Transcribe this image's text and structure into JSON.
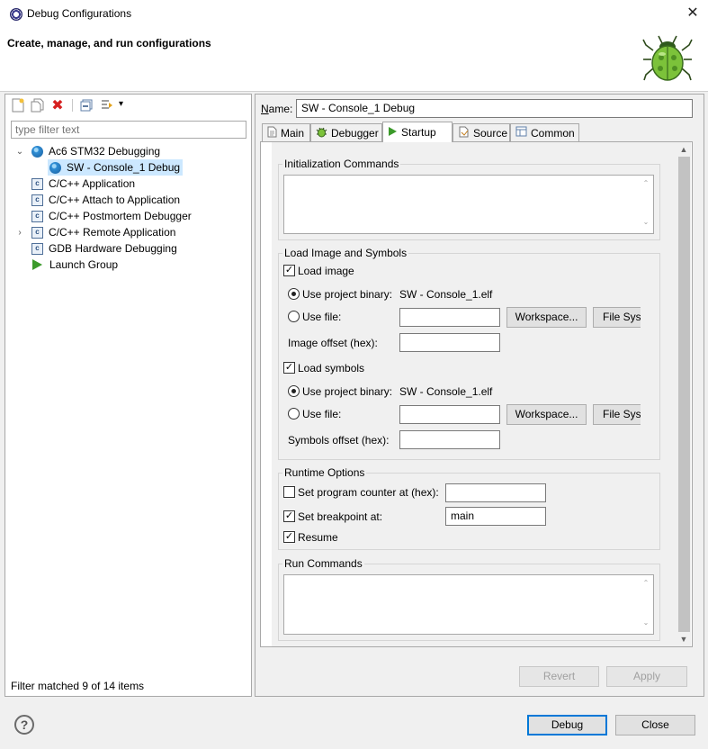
{
  "window": {
    "title": "Debug Configurations",
    "close_glyph": "✕",
    "banner_text": "Create, manage, and run configurations"
  },
  "left": {
    "filter_placeholder": "type filter text",
    "tree": [
      {
        "label": "Ac6 STM32 Debugging",
        "icon": "globe-icon",
        "expanded": true
      },
      {
        "label": "SW - Console_1 Debug",
        "icon": "globe-icon",
        "selected": true
      },
      {
        "label": "C/C++ Application",
        "icon": "c-icon"
      },
      {
        "label": "C/C++ Attach to Application",
        "icon": "c-icon"
      },
      {
        "label": "C/C++ Postmortem Debugger",
        "icon": "c-icon"
      },
      {
        "label": "C/C++ Remote Application",
        "icon": "c-icon",
        "collapsed": true
      },
      {
        "label": "GDB Hardware Debugging",
        "icon": "c-icon"
      },
      {
        "label": "Launch Group",
        "icon": "launch-icon"
      }
    ],
    "status": "Filter matched 9 of 14 items"
  },
  "right": {
    "name_label": "Name:",
    "name_value": "SW - Console_1 Debug",
    "tabs": [
      {
        "label": "Main",
        "icon": "main-icon"
      },
      {
        "label": "Debugger",
        "icon": "bug-small-icon"
      },
      {
        "label": "Startup",
        "icon": "run-icon",
        "active": true
      },
      {
        "label": "Source",
        "icon": "source-icon"
      },
      {
        "label": "Common",
        "icon": "common-icon"
      }
    ],
    "init": {
      "title": "Initialization Commands"
    },
    "load": {
      "title": "Load Image and Symbols",
      "load_image": "Load image",
      "load_image_checked": true,
      "use_project_binary": "Use project binary:",
      "image_binary": "SW - Console_1.elf",
      "use_file": "Use file:",
      "workspace": "Workspace...",
      "filesystem": "File Syst",
      "image_offset": "Image offset (hex):",
      "load_symbols": "Load symbols",
      "load_symbols_checked": true,
      "symbols_binary": "SW - Console_1.elf",
      "symbols_offset": "Symbols offset (hex):"
    },
    "runtime": {
      "title": "Runtime Options",
      "set_pc": "Set program counter at (hex):",
      "set_pc_checked": false,
      "set_bp": "Set breakpoint at:",
      "set_bp_checked": true,
      "bp_value": "main",
      "resume": "Resume",
      "resume_checked": true
    },
    "run": {
      "title": "Run Commands"
    },
    "revert": "Revert",
    "apply": "Apply"
  },
  "footer": {
    "help_glyph": "?",
    "debug": "Debug",
    "close": "Close"
  },
  "glyphs": {
    "check": "✓",
    "up": "⌃",
    "down": "⌄",
    "scroll_up": "▲",
    "scroll_down": "▼",
    "expanded": "⌄",
    "collapsed": "›",
    "dropdown": "▾"
  }
}
